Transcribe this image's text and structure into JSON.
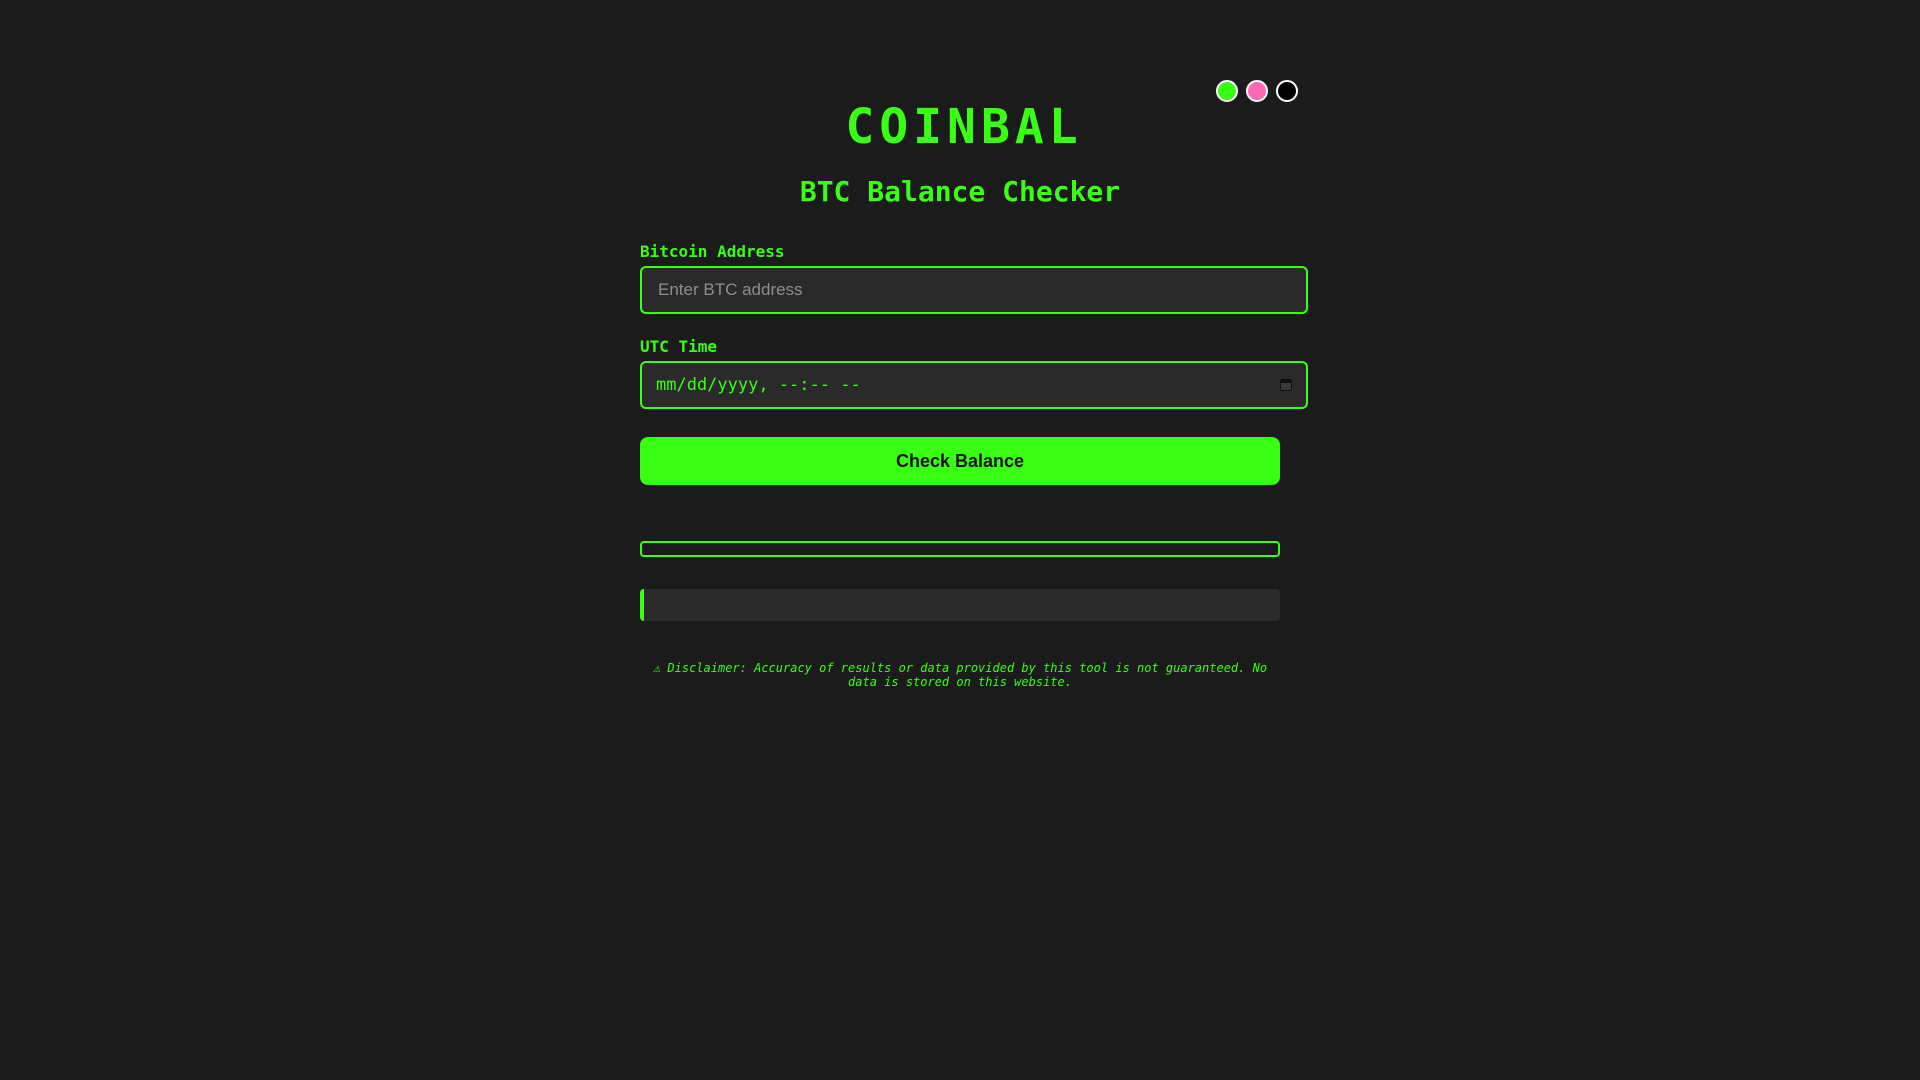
{
  "theme_switcher": {
    "options": [
      {
        "name": "green",
        "color": "#39ff14"
      },
      {
        "name": "pink",
        "color": "#ff69b4"
      },
      {
        "name": "black",
        "color": "#000000"
      }
    ]
  },
  "header": {
    "title": "COINBAL",
    "subtitle": "BTC Balance Checker"
  },
  "form": {
    "address_label": "Bitcoin Address",
    "address_placeholder": "Enter BTC address",
    "address_value": "",
    "time_label": "UTC Time",
    "time_value": "mm/dd/yyyy, --:-- --",
    "submit_label": "Check Balance"
  },
  "progress": {
    "fraction": 0
  },
  "result": {
    "text": ""
  },
  "disclaimer": "⚠ Disclaimer: Accuracy of results or data provided by this tool is not guaranteed. No data is stored on this website.",
  "colors": {
    "accent": "#39ff14",
    "background": "#1b1b1b",
    "field_background": "#2a2a2a"
  }
}
